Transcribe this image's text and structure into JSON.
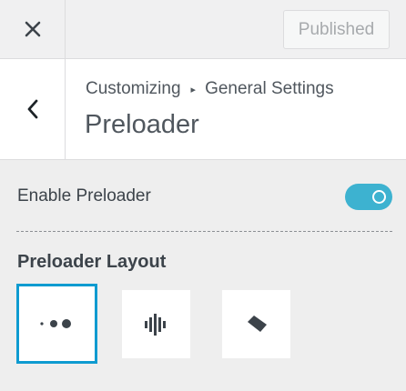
{
  "topbar": {
    "close_icon": "close-icon",
    "publish_label": "Published"
  },
  "header": {
    "back_icon": "chevron-left-icon",
    "breadcrumb": {
      "root": "Customizing",
      "separator": "▸",
      "section": "General Settings"
    },
    "title": "Preloader"
  },
  "controls": {
    "enable_label": "Enable Preloader",
    "enable_on": true,
    "layout_label": "Preloader Layout",
    "layouts": [
      {
        "name": "dots",
        "icon": "three-dots-icon",
        "selected": true
      },
      {
        "name": "bars",
        "icon": "audio-bars-icon",
        "selected": false
      },
      {
        "name": "square",
        "icon": "rotated-square-icon",
        "selected": false
      }
    ]
  },
  "colors": {
    "accent": "#3db2d0",
    "selected_border": "#0e9bd0",
    "text": "#50575e"
  }
}
